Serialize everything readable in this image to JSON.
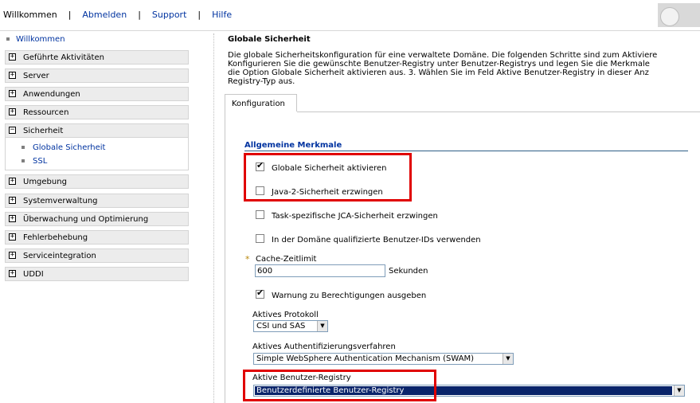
{
  "topnav": {
    "welcome": "Willkommen",
    "logout": "Abmelden",
    "support": "Support",
    "help": "Hilfe",
    "separator": "|"
  },
  "sidebar": {
    "welcome_link": "Willkommen",
    "items": [
      {
        "label": "Geführte Aktivitäten",
        "expander": "+"
      },
      {
        "label": "Server",
        "expander": "+"
      },
      {
        "label": "Anwendungen",
        "expander": "+"
      },
      {
        "label": "Ressourcen",
        "expander": "+"
      },
      {
        "label": "Sicherheit",
        "expander": "−"
      },
      {
        "label": "Umgebung",
        "expander": "+"
      },
      {
        "label": "Systemverwaltung",
        "expander": "+"
      },
      {
        "label": "Überwachung und Optimierung",
        "expander": "+"
      },
      {
        "label": "Fehlerbehebung",
        "expander": "+"
      },
      {
        "label": "Serviceintegration",
        "expander": "+"
      },
      {
        "label": "UDDI",
        "expander": "+"
      }
    ],
    "security_children": [
      "Globale Sicherheit",
      "SSL"
    ]
  },
  "main": {
    "title": "Globale Sicherheit",
    "description": [
      "Die globale Sicherheitskonfiguration für eine verwaltete Domäne. Die folgenden Schritte sind zum Aktiviere",
      "Konfigurieren Sie die gewünschte Benutzer-Registry unter Benutzer-Registrys und legen Sie die Merkmale",
      "die Option Globale Sicherheit aktivieren aus. 3. Wählen Sie im Feld Aktive Benutzer-Registry in dieser Anz",
      "Registry-Typ aus."
    ],
    "tab": "Konfiguration",
    "section": "Allgemeine Merkmale",
    "checkboxes": [
      {
        "label": "Globale Sicherheit aktivieren",
        "checked": true
      },
      {
        "label": "Java-2-Sicherheit erzwingen",
        "checked": false
      },
      {
        "label": "Task-spezifische JCA-Sicherheit erzwingen",
        "checked": false
      },
      {
        "label": "In der Domäne qualifizierte Benutzer-IDs verwenden",
        "checked": false
      }
    ],
    "cache": {
      "required_marker": "*",
      "label": "Cache-Zeitlimit",
      "value": "600",
      "unit": "Sekunden"
    },
    "warn_checkbox": {
      "label": "Warnung zu Berechtigungen ausgeben",
      "checked": true
    },
    "protocol": {
      "label": "Aktives Protokoll",
      "value": "CSI und SAS"
    },
    "auth": {
      "label": "Aktives Authentifizierungsverfahren",
      "value": "Simple WebSphere Authentication Mechanism (SWAM)"
    },
    "registry": {
      "label": "Aktive Benutzer-Registry",
      "value": "Benutzerdefinierte Benutzer-Registry"
    },
    "check_glyph": "✔",
    "dropdown_glyph": "▼"
  },
  "colors": {
    "highlight": "#e00000",
    "link": "#0033a0",
    "selection": "#0a246a"
  }
}
